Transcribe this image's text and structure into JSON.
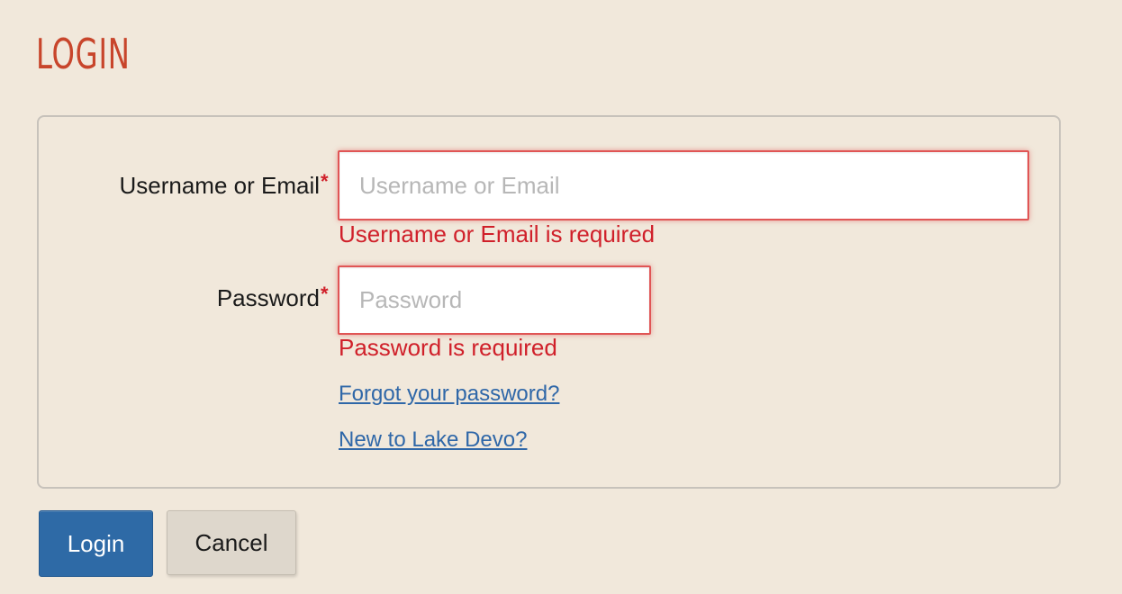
{
  "page": {
    "title": "LOGIN"
  },
  "form": {
    "username": {
      "label": "Username or Email",
      "required_marker": "*",
      "placeholder": "Username or Email",
      "value": "",
      "error": "Username or Email is required"
    },
    "password": {
      "label": "Password",
      "required_marker": "*",
      "placeholder": "Password",
      "value": "",
      "error": "Password is required"
    },
    "links": {
      "forgot_password": "Forgot your password?",
      "new_user": "New to Lake Devo?"
    }
  },
  "actions": {
    "login_label": "Login",
    "cancel_label": "Cancel"
  },
  "colors": {
    "background": "#f1e8db",
    "title": "#c8452b",
    "error": "#d0202a",
    "error_border": "#e05555",
    "link": "#2f67a8",
    "primary_button": "#2e6aa6"
  }
}
